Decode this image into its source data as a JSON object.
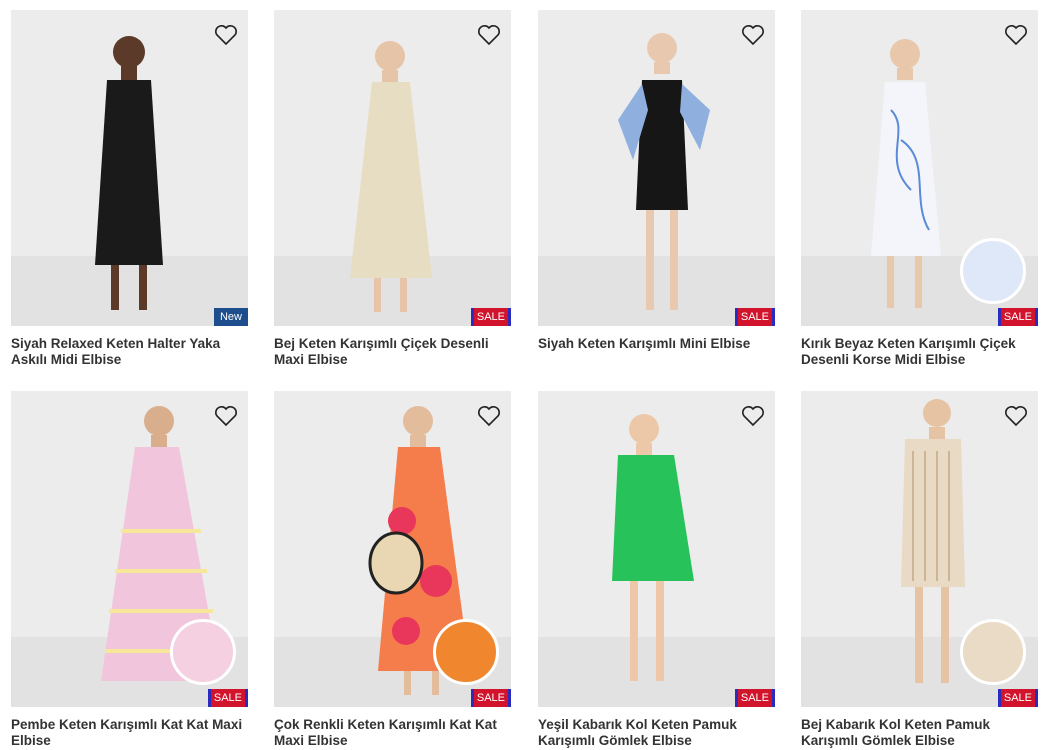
{
  "products": [
    {
      "title": "Siyah Relaxed Keten Halter Yaka Askılı Midi Elbise",
      "badge": "New",
      "dress_color": "#1a1a1a",
      "has_swatch": false
    },
    {
      "title": "Bej Keten Karışımlı Çiçek Desenli Maxi Elbise",
      "badge": "SALE",
      "dress_color": "#e7ddc2",
      "has_swatch": false
    },
    {
      "title": "Siyah Keten Karışımlı Mini Elbise",
      "badge": "SALE",
      "dress_color": "#161616",
      "has_swatch": false
    },
    {
      "title": "Kırık Beyaz Keten Karışımlı Çiçek Desenli Korse Midi Elbise",
      "badge": "SALE",
      "dress_color": "#f3f5fb",
      "has_swatch": true,
      "swatch_color": "#dfe8f8"
    },
    {
      "title": "Pembe Keten Karışımlı Kat Kat Maxi Elbise",
      "badge": "SALE",
      "dress_color": "#f1c6dc",
      "has_swatch": true,
      "swatch_color": "#f4d0e0"
    },
    {
      "title": "Çok Renkli Keten Karışımlı Kat Kat Maxi Elbise",
      "badge": "SALE",
      "dress_color": "#f47d4b",
      "has_swatch": true,
      "swatch_color": "#f0872f"
    },
    {
      "title": "Yeşil Kabarık Kol Keten Pamuk Karışımlı Gömlek Elbise",
      "badge": "SALE",
      "dress_color": "#27c25a",
      "has_swatch": false
    },
    {
      "title": "Bej Kabarık Kol Keten Pamuk Karışımlı Gömlek Elbise",
      "badge": "SALE",
      "dress_color": "#e8dac5",
      "has_swatch": true,
      "swatch_color": "#eadbc6"
    }
  ]
}
